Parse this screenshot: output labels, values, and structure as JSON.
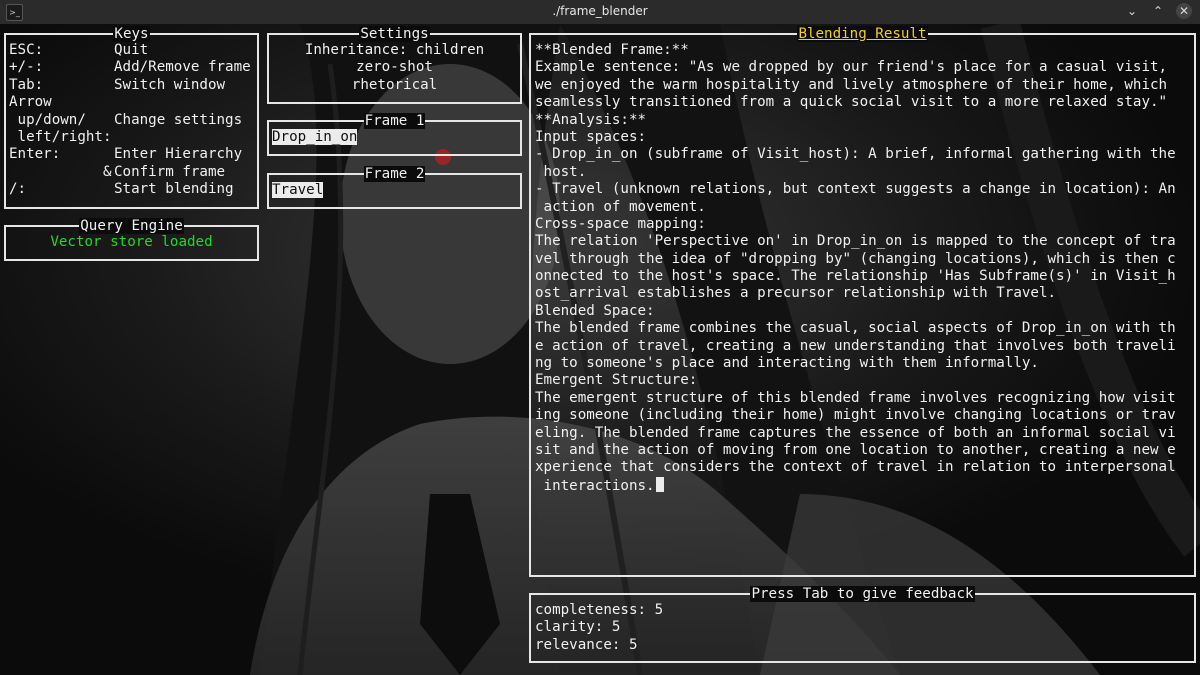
{
  "window": {
    "title": "./frame_blender",
    "app_icon": ">_",
    "buttons": {
      "minimize": "⌄",
      "maximize": "⌃",
      "close": "✕"
    }
  },
  "keys_panel": {
    "title": "Keys",
    "rows": [
      {
        "key": "ESC:",
        "desc": "Quit"
      },
      {
        "key": "+/-:",
        "desc": "Add/Remove frame"
      },
      {
        "key": "Tab:",
        "desc": "Switch window"
      },
      {
        "key": "Arrow",
        "desc": ""
      },
      {
        "key": " up/down/",
        "desc": "Change settings"
      },
      {
        "key": " left/right:",
        "desc": ""
      },
      {
        "key": "Enter:",
        "desc": "Enter Hierarchy"
      },
      {
        "key": "           &",
        "desc": "Confirm frame"
      },
      {
        "key": "/:",
        "desc": "Start blending"
      }
    ]
  },
  "settings_panel": {
    "title": "Settings",
    "lines": [
      "Inheritance: children",
      "zero-shot",
      "rhetorical"
    ]
  },
  "frame1": {
    "title": "Frame 1",
    "value": "Drop_in_on"
  },
  "frame2": {
    "title": "Frame 2",
    "value": "Travel"
  },
  "query_engine": {
    "title": "Query Engine",
    "status": "Vector store loaded",
    "status_color": "#2ad42a"
  },
  "result_panel": {
    "title": "Blending Result",
    "title_color": "#f0d020",
    "lines": [
      "**Blended Frame:**",
      "Example sentence: \"As we dropped by our friend's place for a casual visit,",
      "we enjoyed the warm hospitality and lively atmosphere of their home, which",
      "seamlessly transitioned from a quick social visit to a more relaxed stay.\"",
      "**Analysis:**",
      "Input spaces:",
      "- Drop_in_on (subframe of Visit_host): A brief, informal gathering with the",
      " host.",
      "- Travel (unknown relations, but context suggests a change in location): An",
      " action of movement.",
      "Cross-space mapping:",
      "The relation 'Perspective on' in Drop_in_on is mapped to the concept of tra",
      "vel through the idea of \"dropping by\" (changing locations), which is then c",
      "onnected to the host's space. The relationship 'Has Subframe(s)' in Visit_h",
      "ost_arrival establishes a precursor relationship with Travel.",
      "Blended Space:",
      "The blended frame combines the casual, social aspects of Drop_in_on with th",
      "e action of travel, creating a new understanding that involves both traveli",
      "ng to someone's place and interacting with them informally.",
      "Emergent Structure:",
      "The emergent structure of this blended frame involves recognizing how visit",
      "ing someone (including their home) might involve changing locations or trav",
      "eling. The blended frame captures the essence of both an informal social vi",
      "sit and the action of moving from one location to another, creating a new e",
      "xperience that considers the context of travel in relation to interpersonal",
      " interactions."
    ]
  },
  "feedback_panel": {
    "title": "Press Tab to give feedback",
    "lines": [
      "completeness: 5",
      "clarity: 5",
      "relevance: 5"
    ]
  }
}
